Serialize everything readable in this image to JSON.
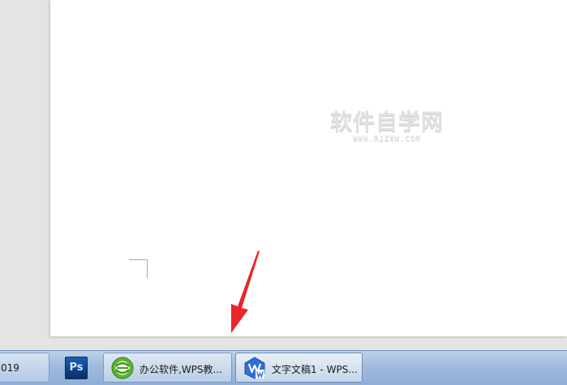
{
  "document": {
    "watermark_main": "软件自学网",
    "watermark_sub": "WWW.RJZXW.COM"
  },
  "annotation": {
    "arrow_color": "#e8262b"
  },
  "taskbar": {
    "items": [
      {
        "label": "019",
        "icon": "app-icon"
      },
      {
        "label": "",
        "icon": "photoshop-icon",
        "icon_text": "Ps"
      },
      {
        "label": "办公软件,WPS教...",
        "icon": "browser-icon"
      },
      {
        "label": "文字文稿1 - WPS...",
        "icon": "wps-writer-icon"
      }
    ]
  }
}
